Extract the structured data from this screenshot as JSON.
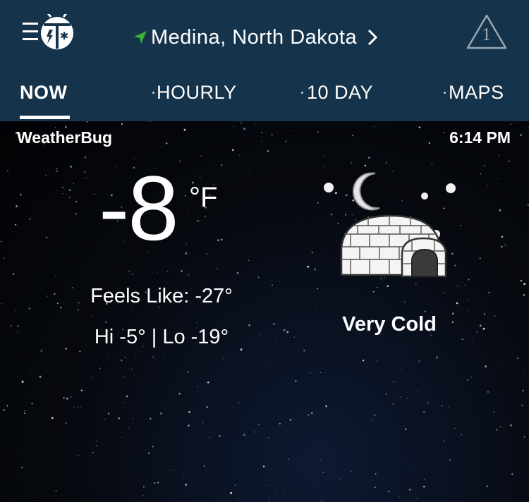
{
  "header": {
    "menu_icon": "hamburger-icon",
    "logo_icon": "weatherbug-logo-icon",
    "location": {
      "icon": "navigation-arrow-icon",
      "text": "Medina,  North  Dakota",
      "chevron_icon": "chevron-right-icon"
    },
    "alert": {
      "icon": "alert-triangle-icon",
      "count": "1"
    },
    "colors": {
      "bar": "#15334a",
      "location_arrow": "#3fae3a"
    }
  },
  "tabs": [
    {
      "label": "NOW",
      "active": true
    },
    {
      "label": "HOURLY",
      "active": false
    },
    {
      "label": "10  DAY",
      "active": false
    },
    {
      "label": "MAPS",
      "active": false
    }
  ],
  "current": {
    "source": "WeatherBug",
    "time": "6:14 PM",
    "temperature": "-8",
    "unit": "°F",
    "feels_like": "Feels Like: -27°",
    "hi_lo": "Hi -5° | Lo -19°",
    "condition": "Very Cold",
    "condition_icon": "igloo-moon-icon"
  }
}
